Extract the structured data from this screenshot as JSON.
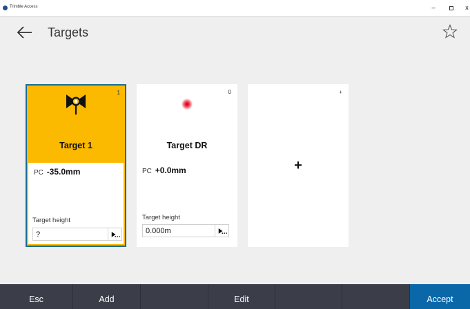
{
  "window": {
    "title": "Trimble Access",
    "minimize": "–",
    "close": "x"
  },
  "header": {
    "title": "Targets"
  },
  "cards": [
    {
      "number": "1",
      "name": "Target 1",
      "pc_label": "PC",
      "pc_value": "-35.0mm",
      "height_label": "Target height",
      "height_value": "?",
      "selected": true
    },
    {
      "number": "0",
      "name": "Target DR",
      "pc_label": "PC",
      "pc_value": "+0.0mm",
      "height_label": "Target height",
      "height_value": "0.000m",
      "selected": false
    }
  ],
  "add_card": {
    "corner": "+",
    "plus": "+"
  },
  "bottom": {
    "esc": "Esc",
    "add": "Add",
    "edit": "Edit",
    "accept": "Accept"
  },
  "colors": {
    "selected_card": "#fbb900",
    "selected_border": "#1a6d92",
    "accept": "#0a67a8",
    "bar": "#3b3e48",
    "laser_dot": "#e8233a"
  }
}
